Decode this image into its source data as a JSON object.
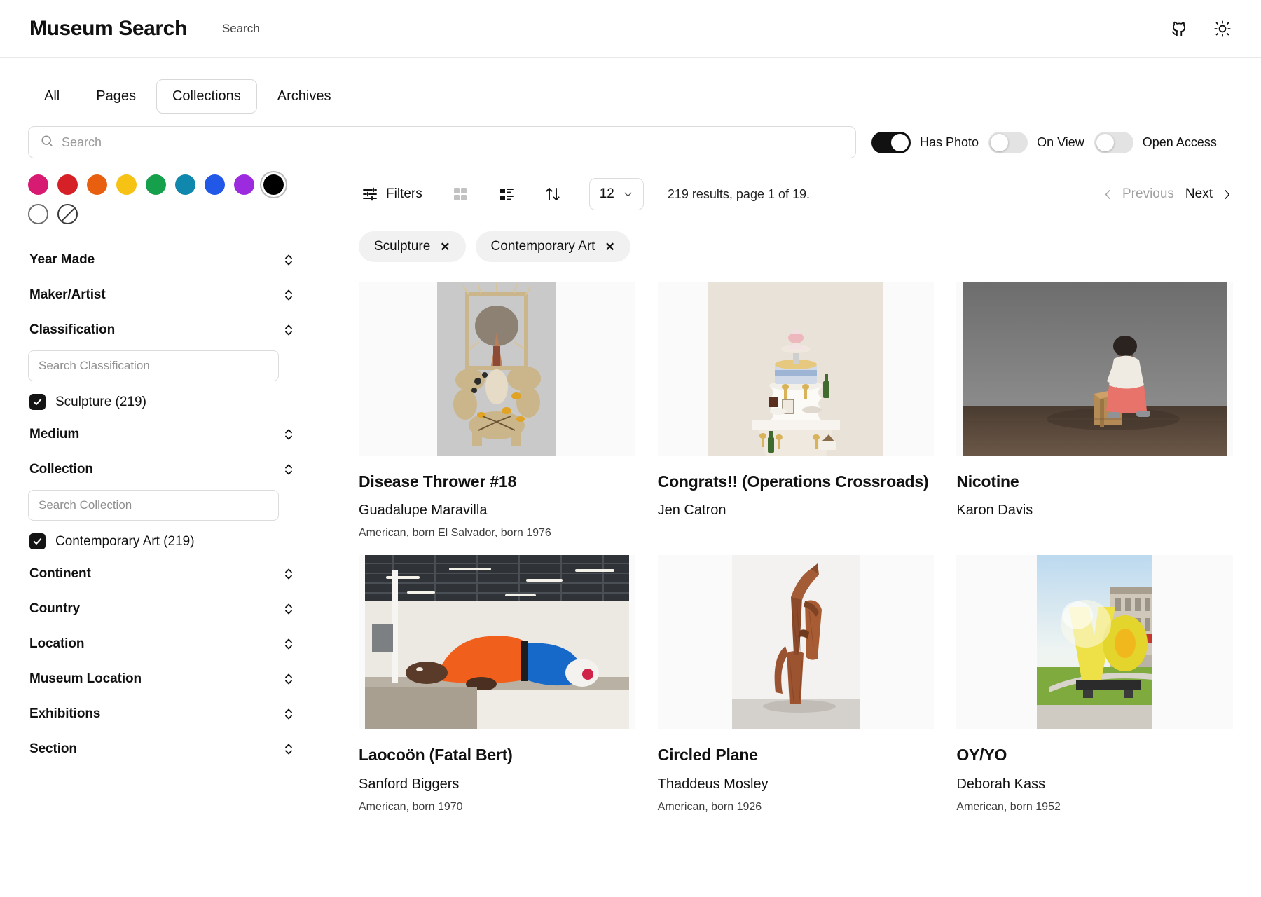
{
  "header": {
    "brand": "Museum Search",
    "nav_link": "Search",
    "icons": {
      "github": "github-icon",
      "theme": "sun-icon"
    }
  },
  "tabs": [
    {
      "label": "All",
      "active": false
    },
    {
      "label": "Pages",
      "active": false
    },
    {
      "label": "Collections",
      "active": true
    },
    {
      "label": "Archives",
      "active": false
    }
  ],
  "search": {
    "value": "",
    "placeholder": "Search",
    "icon": "search-icon"
  },
  "toggles": [
    {
      "label": "Has Photo",
      "on": true
    },
    {
      "label": "On View",
      "on": false
    },
    {
      "label": "Open Access",
      "on": false
    }
  ],
  "colors": [
    {
      "name": "pink",
      "hex": "#D81B72"
    },
    {
      "name": "red",
      "hex": "#D62027"
    },
    {
      "name": "orange",
      "hex": "#E8600F"
    },
    {
      "name": "yellow",
      "hex": "#F6C213"
    },
    {
      "name": "green",
      "hex": "#16A04B"
    },
    {
      "name": "teal",
      "hex": "#1088AD"
    },
    {
      "name": "blue",
      "hex": "#2158E8"
    },
    {
      "name": "purple",
      "hex": "#9C2BE0"
    },
    {
      "name": "black",
      "hex": "#000000",
      "selected": true
    },
    {
      "name": "white",
      "hex": "#FFFFFF",
      "outline": true
    },
    {
      "name": "no-color",
      "hex": "#FFFFFF",
      "none": true
    }
  ],
  "facets": [
    {
      "label": "Year Made",
      "type": "accordion"
    },
    {
      "label": "Maker/Artist",
      "type": "accordion"
    },
    {
      "label": "Classification",
      "type": "accordion",
      "search_placeholder": "Search Classification",
      "options": [
        {
          "label": "Sculpture (219)",
          "checked": true
        }
      ]
    },
    {
      "label": "Medium",
      "type": "accordion"
    },
    {
      "label": "Collection",
      "type": "accordion",
      "search_placeholder": "Search Collection",
      "options": [
        {
          "label": "Contemporary Art (219)",
          "checked": true
        }
      ]
    },
    {
      "label": "Continent",
      "type": "accordion"
    },
    {
      "label": "Country",
      "type": "accordion"
    },
    {
      "label": "Location",
      "type": "accordion"
    },
    {
      "label": "Museum Location",
      "type": "accordion"
    },
    {
      "label": "Exhibitions",
      "type": "accordion"
    },
    {
      "label": "Section",
      "type": "accordion"
    }
  ],
  "toolbar": {
    "filters_label": "Filters",
    "grid_view_label": "grid-view",
    "list_view_label": "list-view",
    "sort_label": "sort",
    "per_page": "12",
    "results_text": "219 results, page 1 of 19.",
    "previous_label": "Previous",
    "next_label": "Next"
  },
  "active_filters": [
    {
      "label": "Sculpture",
      "remove": "✕"
    },
    {
      "label": "Contemporary Art",
      "remove": "✕"
    }
  ],
  "results": [
    {
      "title": "Disease Thrower #18",
      "artist": "Guadalupe Maravilla",
      "meta": "American, born El Salvador, born 1976",
      "image": "sculpture-assemblage-gray-bg"
    },
    {
      "title": "Congrats!! (Operations Crossroads)",
      "artist": "Jen Catron",
      "meta": "",
      "image": "cake-on-table-cream-bg"
    },
    {
      "title": "Nicotine",
      "artist": "Karon Davis",
      "meta": "",
      "image": "seated-figure-gray-gallery"
    },
    {
      "title": "Laocoön (Fatal Bert)",
      "artist": "Sanford Biggers",
      "meta": "American, born 1970",
      "image": "inflatable-figure-warehouse"
    },
    {
      "title": "Circled Plane",
      "artist": "Thaddeus Mosley",
      "meta": "American, born 1926",
      "image": "wood-sculpture-white-wall"
    },
    {
      "title": "OY/YO",
      "artist": "Deborah Kass",
      "meta": "American, born 1952",
      "image": "yellow-yo-outdoor-sculpture"
    }
  ]
}
